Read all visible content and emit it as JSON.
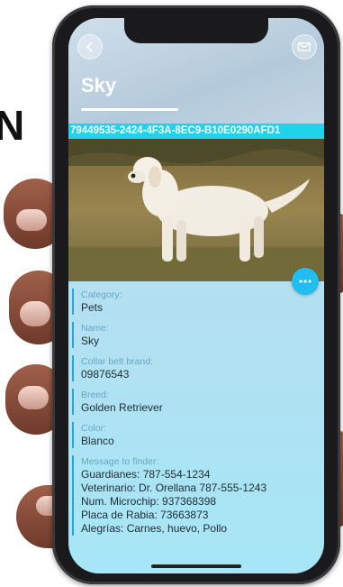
{
  "background": {
    "letter": "N"
  },
  "header": {
    "title": "Sky",
    "uuid": "79449535-2424-4F3A-8EC9-B10E0290AFD1"
  },
  "icons": {
    "back": "chevron-left-icon",
    "mail": "envelope-icon",
    "more": "ellipsis-icon"
  },
  "fields": [
    {
      "label": "Category:",
      "value": "Pets"
    },
    {
      "label": "Name:",
      "value": "Sky"
    },
    {
      "label": "Collar belt brand:",
      "value": "09876543"
    },
    {
      "label": "Breed:",
      "value": "Golden Retriever"
    },
    {
      "label": "Color:",
      "value": "Blanco"
    }
  ],
  "message": {
    "label": "Message to finder:",
    "lines": [
      "Guardianes: 787-554-1234",
      "Veterinario: Dr. Orellana 787-555-1243",
      "Num. Microchip: 937368398",
      "Placa de Rabia: 73663873",
      "Alegrías: Carnes, huevo, Pollo"
    ]
  },
  "colors": {
    "accent": "#20d3ea",
    "more_button": "#1fbdf0"
  }
}
